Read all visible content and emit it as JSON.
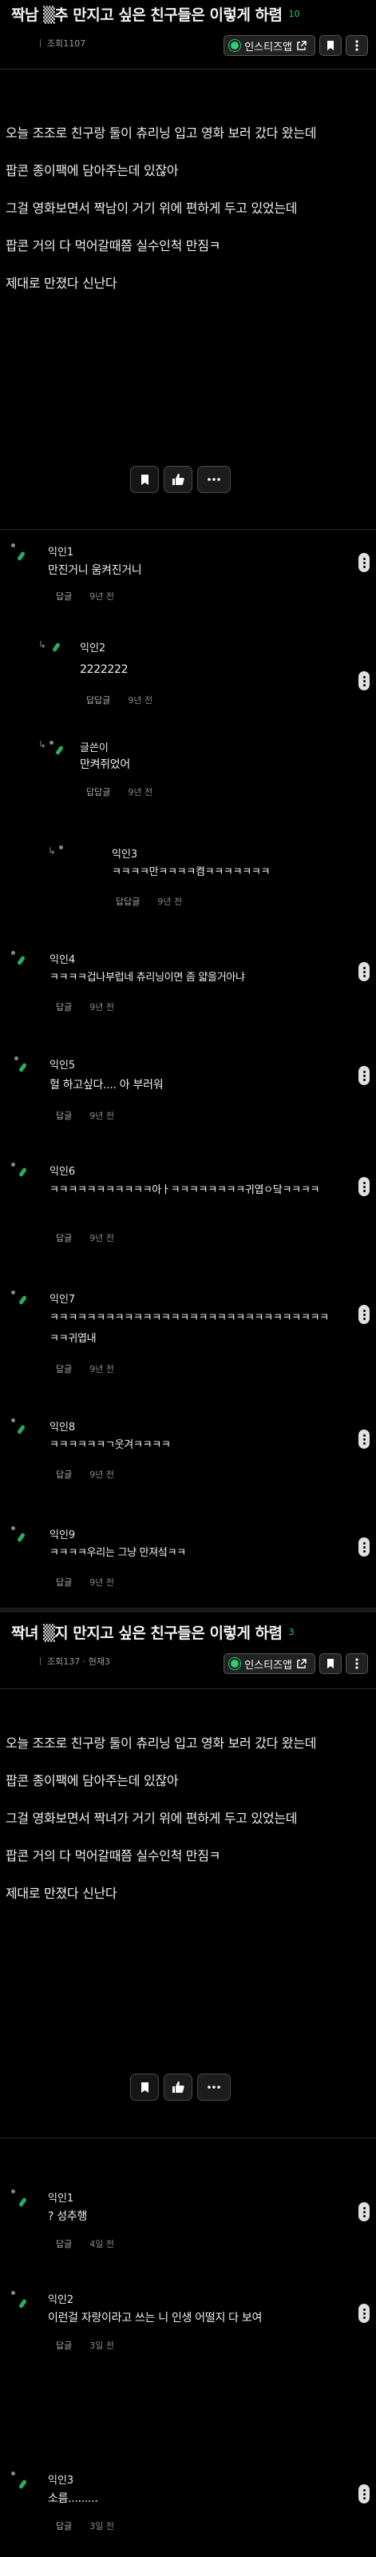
{
  "post1": {
    "title": "짝남 ▒추 만지고 싶은 친구들은 이렇게 하렴",
    "comment_count": "10",
    "meta": "조회1107",
    "insta_label": "인스티즈앱",
    "body": [
      "오늘 조조로 친구랑 둘이 츄리닝 입고 영화 보러 갔다 왔는데",
      "팝콘 종이팩에 담아주는데 있잖아",
      "그걸 영화보면서 짝남이 거기 위에 편하게 두고 있었는데",
      "팝콘 거의 다 먹어갈때쯤 실수인척 만짐ㅋ",
      "제대로 만졌다 신난다"
    ],
    "comments": [
      {
        "name": "익인1",
        "text": "만진거니 움켜진거니",
        "reply": "답글",
        "time": "9년 전"
      },
      {
        "name": "익인2",
        "text": "2222222",
        "reply": "답답글",
        "time": "9년 전"
      },
      {
        "name": "글쓴이",
        "text": "만켜쥐었어",
        "reply": "답답글",
        "time": "9년 전"
      },
      {
        "name": "익인3",
        "text": "ㅋㅋㅋㅋ만ㅋㅋㅋㅋ켬ㅋㅋㅋㅋㅋㅋㅋ",
        "reply": "답답글",
        "time": "9년 전"
      },
      {
        "name": "익인4",
        "text": "ㅋㅋㅋㅋ겁나부럽네 츄리닝이면 좀 얇을거아냐",
        "reply": "답글",
        "time": "9년 전"
      },
      {
        "name": "익인5",
        "text": "헐 하고싶다.... 아 부러워",
        "reply": "답글",
        "time": "9년 전"
      },
      {
        "name": "익인6",
        "text": "ㅋㅋㅋㅋㅋㅋㅋㅋㅋㅋㅋ아ㅏㅋㅋㅋㅋㅋㅋㅋㅋ귀엽ㅇ닼ㅋㅋㅋㅋ",
        "reply": "답글",
        "time": "9년 전"
      },
      {
        "name": "익인7",
        "text": "ㅋㅋㅋㅋㅋㅋㅋㅋㅋㅋㅋㅋㅋㅋㅋㅋㅋㅋㅋㅋㅋㅋㅋㅋㅋㅋㅋㅋㅋㅋㅋㅋ귀엽내",
        "reply": "답글",
        "time": "9년 전"
      },
      {
        "name": "익인8",
        "text": "ㅋㅋㅋㅋㅋㅋㄱ웃겨ㅋㅋㅋㅋ",
        "reply": "답글",
        "time": "9년 전"
      },
      {
        "name": "익인9",
        "text": "ㅋㅋㅋㅋ우리는 그냥 만져섴ㅋㅋ",
        "reply": "답글",
        "time": "9년 전"
      }
    ]
  },
  "post2": {
    "title": "짝녀 ▒지 만지고 싶은 친구들은 이렇게 하렴",
    "comment_count": "3",
    "meta": "조회137 · 현재3",
    "insta_label": "인스티즈앱",
    "body": [
      "오늘 조조로 친구랑 둘이 츄리닝 입고 영화 보러 갔다 왔는데",
      "팝콘 종이팩에 담아주는데 있잖아",
      "그걸 영화보면서 짝녀가 거기 위에 편하게 두고 있었는데",
      "팝콘 거의 다 먹어갈때쯤 실수인척 만짐ㅋ",
      "제대로 만졌다 신난다"
    ],
    "comments": [
      {
        "name": "익인1",
        "text": "? 성추행",
        "reply": "답글",
        "time": "4일 전"
      },
      {
        "name": "익인2",
        "text": "이런걸 자랑이라고 쓰는 니 인생 어떨지 다 보여",
        "reply": "답글",
        "time": "3일 전"
      },
      {
        "name": "익인3",
        "text": "소름.........",
        "reply": "답글",
        "time": "3일 전"
      }
    ]
  },
  "colors": {
    "accent": "#2ecc71",
    "background": "#000000"
  }
}
